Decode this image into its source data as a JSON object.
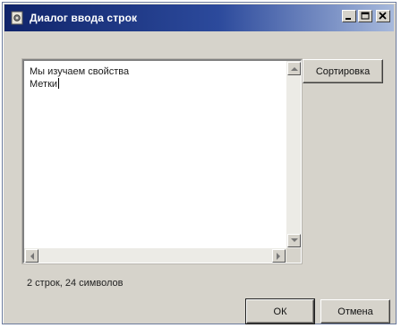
{
  "window": {
    "title": "Диалог ввода строк",
    "icon": "gear-app-icon",
    "title_color_start": "#10246a",
    "title_color_end": "#a7b9dc"
  },
  "memo": {
    "lines": [
      "Мы изучаем свойства",
      "Метки"
    ]
  },
  "buttons": {
    "sort_label": "Сортировка",
    "ok_label": "ОК",
    "cancel_label": "Отмена"
  },
  "status": {
    "text": "2 строк, 24 символов"
  }
}
